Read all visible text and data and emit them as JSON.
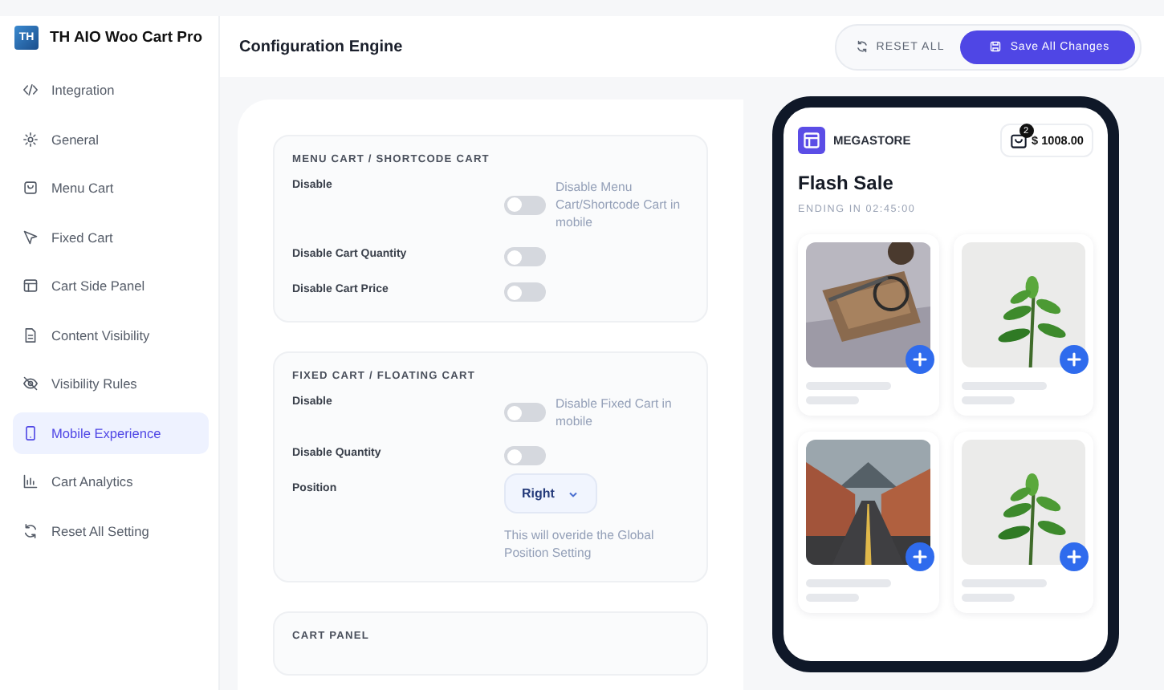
{
  "app": {
    "name": "TH AIO Woo Cart Pro",
    "logo": "TH"
  },
  "sidebar": {
    "items": [
      {
        "label": "Integration",
        "selected": false
      },
      {
        "label": "General",
        "selected": false
      },
      {
        "label": "Menu Cart",
        "selected": false
      },
      {
        "label": "Fixed Cart",
        "selected": false
      },
      {
        "label": "Cart Side Panel",
        "selected": false
      },
      {
        "label": "Content Visibility",
        "selected": false
      },
      {
        "label": "Visibility Rules",
        "selected": false
      },
      {
        "label": "Mobile Experience",
        "selected": true
      },
      {
        "label": "Cart Analytics",
        "selected": false
      },
      {
        "label": "Reset All Setting",
        "selected": false
      }
    ]
  },
  "header": {
    "title": "Configuration Engine",
    "reset_button": "RESET ALL",
    "save_button": "Save All Changes"
  },
  "sections": [
    {
      "title": "MENU CART / SHORTCODE CART",
      "rows": [
        {
          "kind": "toggle",
          "label": "Disable",
          "on": false,
          "help": "Disable Menu Cart/Shortcode Cart in mobile"
        },
        {
          "kind": "toggle",
          "label": "Disable Cart Quantity",
          "on": false
        },
        {
          "kind": "toggle",
          "label": "Disable Cart Price",
          "on": false
        }
      ]
    },
    {
      "title": "FIXED CART / FLOATING CART",
      "rows": [
        {
          "kind": "toggle",
          "label": "Disable",
          "on": false,
          "help": "Disable Fixed Cart in mobile"
        },
        {
          "kind": "toggle",
          "label": "Disable Quantity",
          "on": false
        },
        {
          "kind": "select",
          "label": "Position",
          "value": "Right",
          "help": "This will overide the Global Position Setting"
        }
      ]
    },
    {
      "title": "CART PANEL"
    }
  ],
  "preview": {
    "store": "MEGASTORE",
    "cart_count": "2",
    "cart_total": "$ 1008.00",
    "heading": "Flash Sale",
    "countdown": "ENDING IN 02:45:00"
  }
}
